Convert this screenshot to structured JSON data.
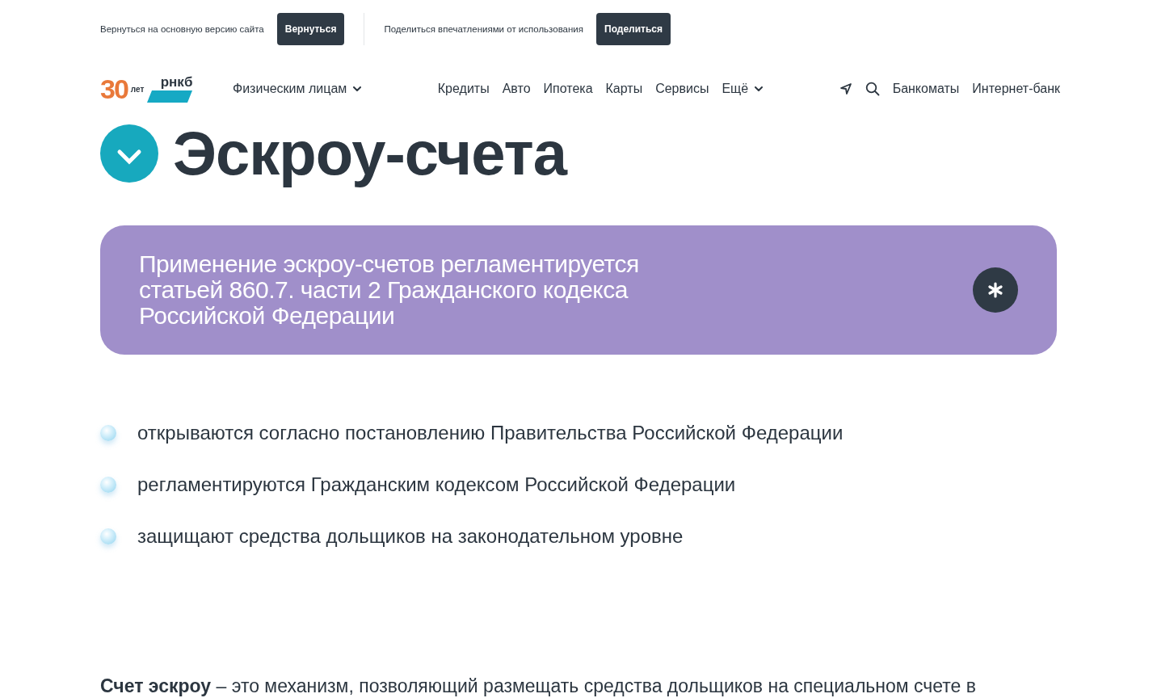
{
  "top_bar": {
    "sections": [
      {
        "text": "Вернуться на основную версию сайта",
        "button": "Вернуться"
      },
      {
        "text": "Поделиться впечатлениями от использования",
        "button": "Поделиться"
      }
    ]
  },
  "header": {
    "logo": {
      "years": "30",
      "years_label": "лет",
      "brand": "рнкб"
    },
    "segment": {
      "label": "Физическим лицам",
      "dropdown": true
    },
    "nav": [
      {
        "label": "Кредиты",
        "dropdown": false
      },
      {
        "label": "Авто",
        "dropdown": false
      },
      {
        "label": "Ипотека",
        "dropdown": false
      },
      {
        "label": "Карты",
        "dropdown": false
      },
      {
        "label": "Сервисы",
        "dropdown": false
      },
      {
        "label": "Ещё",
        "dropdown": true
      }
    ],
    "links": [
      "Банкоматы",
      "Интернет-банк"
    ]
  },
  "page": {
    "title": "Эскроу-счета",
    "callout": "Применение эскроу-счетов регламентируется статьей 860.7. части 2 Гражданского кодекса Российской Федерации",
    "bullets": [
      "открываются согласно постановлению Правительства Российской Федерации",
      "регламентируются Гражданским кодексом Российской Федерации",
      "защищают средства дольщиков на законодательном уровне"
    ],
    "paragraph": "**Счет эскроу** – это механизм, позволяющий размещать средства дольщиков на специальном счете в"
  }
}
